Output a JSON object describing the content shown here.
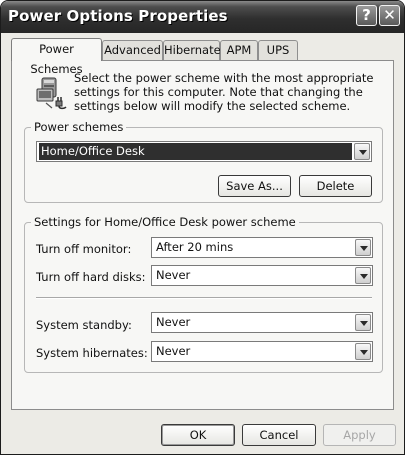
{
  "window": {
    "title": "Power Options Properties",
    "help_glyph": "?",
    "close_glyph": "✕"
  },
  "tabs": [
    {
      "label": "Power Schemes",
      "active": true
    },
    {
      "label": "Advanced",
      "active": false
    },
    {
      "label": "Hibernate",
      "active": false
    },
    {
      "label": "APM",
      "active": false
    },
    {
      "label": "UPS",
      "active": false
    }
  ],
  "intro": {
    "icon": "power-scheme-computer-icon",
    "text": "Select the power scheme with the most appropriate settings for this computer. Note that changing the settings below will modify the selected scheme."
  },
  "power_schemes": {
    "group_label": "Power schemes",
    "selected": "Home/Office Desk",
    "save_as_label": "Save As...",
    "delete_label": "Delete"
  },
  "settings": {
    "group_label": "Settings for Home/Office Desk power scheme",
    "rows": [
      {
        "label": "Turn off monitor:",
        "value": "After 20 mins"
      },
      {
        "label": "Turn off hard disks:",
        "value": "Never"
      },
      {
        "label": "System standby:",
        "value": "Never"
      },
      {
        "label": "System hibernates:",
        "value": "Never"
      }
    ]
  },
  "footer": {
    "ok_label": "OK",
    "cancel_label": "Cancel",
    "apply_label": "Apply"
  }
}
